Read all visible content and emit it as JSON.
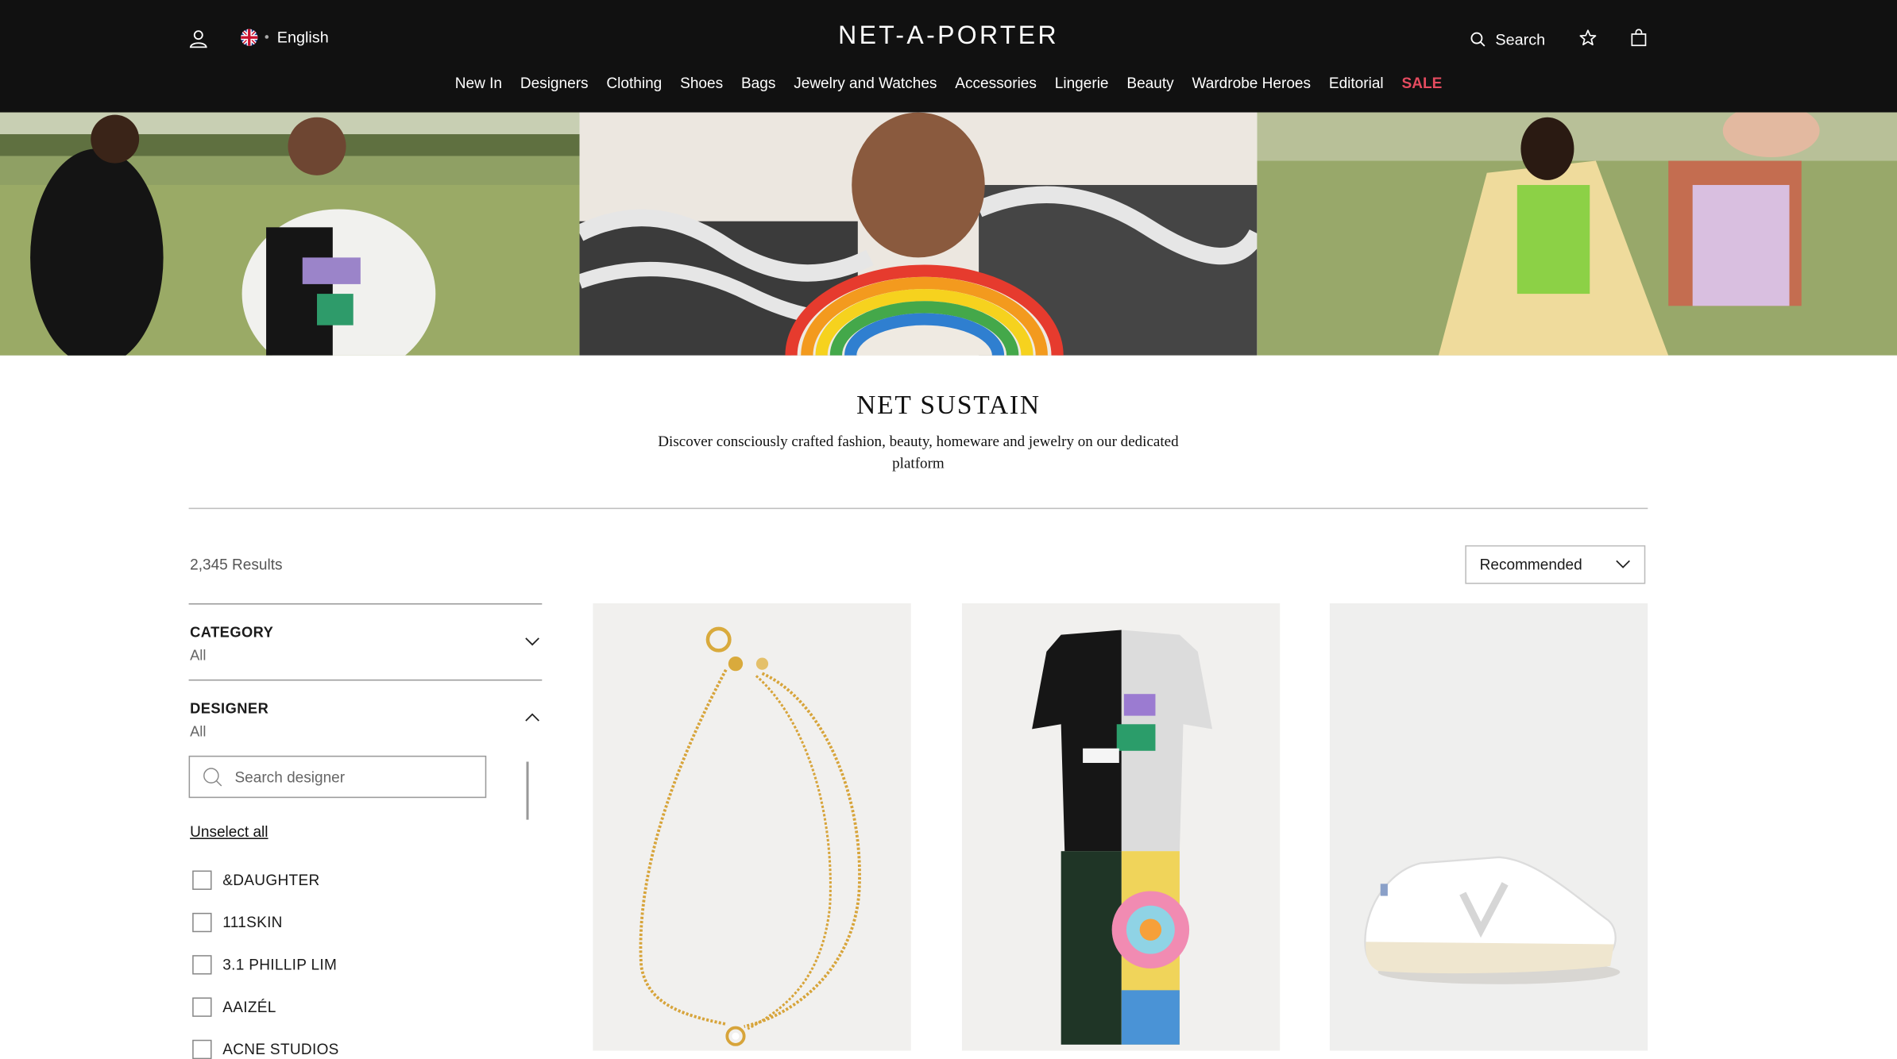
{
  "header": {
    "language": "English",
    "logo": "NET-A-PORTER",
    "search_label": "Search"
  },
  "nav": {
    "items": [
      "New In",
      "Designers",
      "Clothing",
      "Shoes",
      "Bags",
      "Jewelry and Watches",
      "Accessories",
      "Lingerie",
      "Beauty",
      "Wardrobe Heroes",
      "Editorial"
    ],
    "sale": "SALE"
  },
  "page": {
    "title": "NET SUSTAIN",
    "subtitle": "Discover consciously crafted fashion, beauty, homeware and jewelry on our dedicated platform",
    "results": "2,345 Results",
    "sort_value": "Recommended"
  },
  "filters": {
    "category": {
      "title": "CATEGORY",
      "value": "All"
    },
    "designer": {
      "title": "DESIGNER",
      "value": "All",
      "search_placeholder": "Search designer",
      "unselect_all": "Unselect all",
      "options": [
        "&DAUGHTER",
        "111SKIN",
        "3.1 PHILLIP LIM",
        "AAIZÉL",
        "ACNE STUDIOS"
      ]
    }
  },
  "colors": {
    "header_bg": "#111111",
    "sale": "#e54b5f"
  }
}
